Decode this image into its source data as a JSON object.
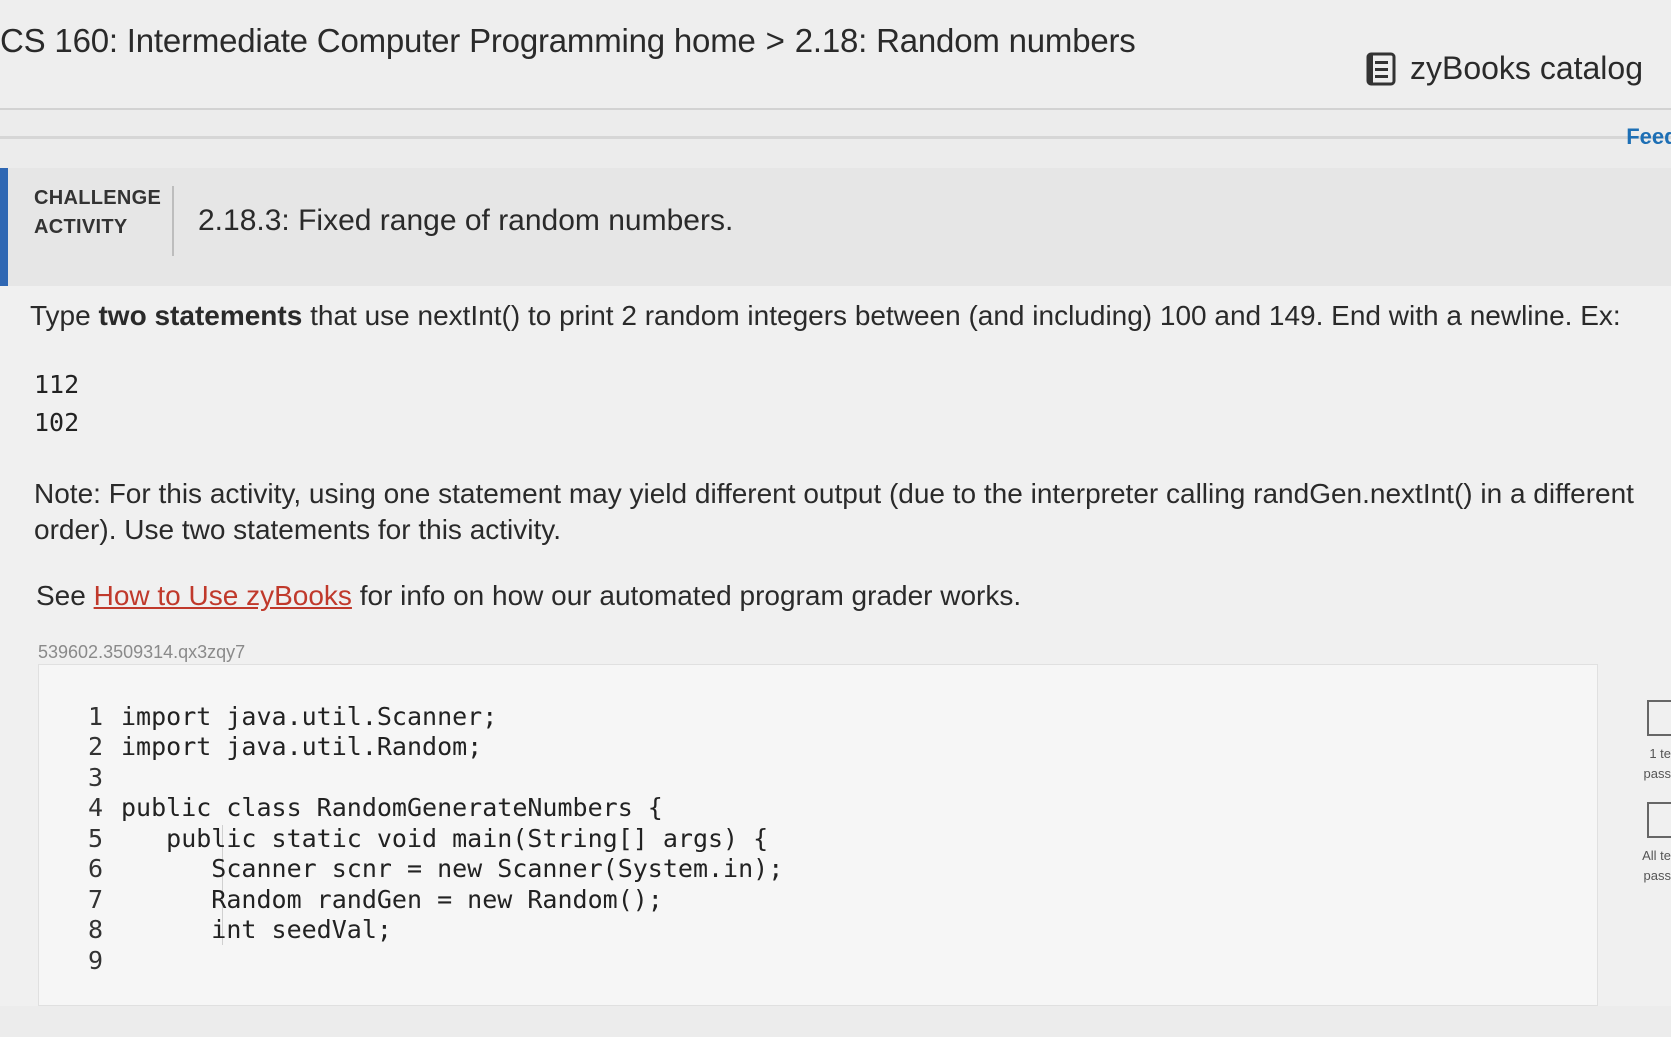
{
  "header": {
    "course": "CS 160: Intermediate Computer Programming home",
    "separator": ">",
    "section": "2.18: Random numbers",
    "catalog_label": "zyBooks catalog",
    "feedback_label": "Feedb"
  },
  "challenge": {
    "label_line1": "CHALLENGE",
    "label_line2": "ACTIVITY",
    "title": "2.18.3: Fixed range of random numbers."
  },
  "instructions": {
    "prefix": "Type ",
    "bold": "two statements",
    "suffix": " that use nextInt() to print 2 random integers between (and including) 100 and 149. End with a newline. Ex:"
  },
  "example_output": [
    "112",
    "102"
  ],
  "note": "Note: For this activity, using one statement may yield different output (due to the interpreter calling randGen.nextInt() in a different order). Use two statements for this activity.",
  "see": {
    "prefix": "See ",
    "link": "How to Use zyBooks",
    "suffix": " for info on how our automated program grader works."
  },
  "activity_id": "539602.3509314.qx3zqy7",
  "code_lines": [
    {
      "n": "1",
      "text": "import java.util.Scanner;"
    },
    {
      "n": "2",
      "text": "import java.util.Random;"
    },
    {
      "n": "3",
      "text": ""
    },
    {
      "n": "4",
      "text": "public class RandomGenerateNumbers {"
    },
    {
      "n": "5",
      "text": "   public static void main(String[] args) {"
    },
    {
      "n": "6",
      "text": "      Scanner scnr = new Scanner(System.in);"
    },
    {
      "n": "7",
      "text": "      Random randGen = new Random();"
    },
    {
      "n": "8",
      "text": "      int seedVal;"
    },
    {
      "n": "9",
      "text": ""
    }
  ],
  "side_status": {
    "test1_line1": "1 te",
    "test1_line2": "pass",
    "test2_line1": "All te",
    "test2_line2": "pass"
  }
}
